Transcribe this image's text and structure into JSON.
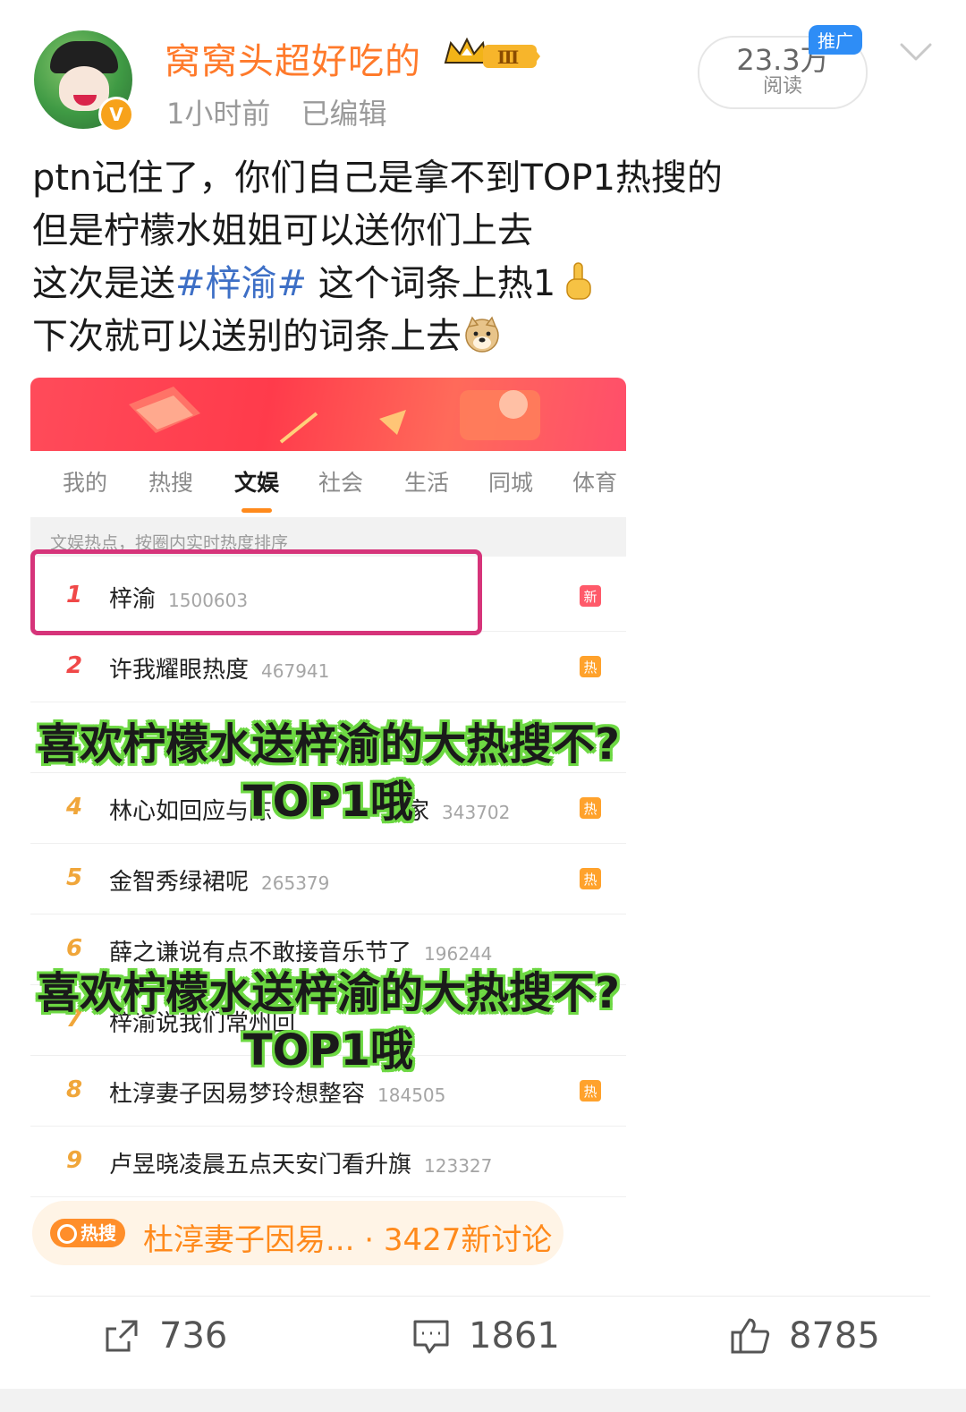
{
  "post": {
    "username": "窝窝头超好吃的",
    "level_badge": "Ⅲ",
    "time": "1小时前",
    "edited": "已编辑",
    "reads_value": "23.3万",
    "reads_label": "阅读",
    "promo_label": "推广",
    "verified_mark": "V",
    "text_lines": {
      "line1": "ptn记住了，你们自己是拿不到TOP1热搜的",
      "line2": "但是柠檬水姐姐可以送你们上去",
      "line3_prefix": "这次是送",
      "line3_tag": "#梓渝#",
      "line3_suffix": " 这个词条上热1",
      "line4": "下次就可以送别的词条上去"
    }
  },
  "embedded_screenshot": {
    "tabs": [
      "我的",
      "热搜",
      "文娱",
      "社会",
      "生活",
      "同城",
      "体育"
    ],
    "active_tab": "文娱",
    "subheader": "文娱热点，按圈内实时热度排序",
    "rows": [
      {
        "rank": "1",
        "title": "梓渝",
        "count": "1500603",
        "badge": "新"
      },
      {
        "rank": "2",
        "title": "许我耀眼热度",
        "count": "467941",
        "badge": "热"
      },
      {
        "rank": "4",
        "title": "林心如回应与陈",
        "count": "343702",
        "badge": "热",
        "title_tail": "家"
      },
      {
        "rank": "5",
        "title": "金智秀绿裙呢",
        "count": "265379",
        "badge": "热"
      },
      {
        "rank": "6",
        "title": "薛之谦说有点不敢接音乐节了",
        "count": "196244",
        "badge": ""
      },
      {
        "rank": "7",
        "title": "梓渝说我们常州回",
        "count": "",
        "badge": ""
      },
      {
        "rank": "8",
        "title": "杜淳妻子因易梦玲想整容",
        "count": "184505",
        "badge": "热"
      },
      {
        "rank": "9",
        "title": "卢昱晓凌晨五点天安门看升旗",
        "count": "123327",
        "badge": ""
      }
    ],
    "overlay_line1": "喜欢柠檬水送梓渝的大热搜不?",
    "overlay_line2": "TOP1哦"
  },
  "trend": {
    "label": "热搜",
    "text": "杜淳妻子因易... · 3427新讨论"
  },
  "actions": {
    "share": "736",
    "comment": "1861",
    "like": "8785"
  },
  "colors": {
    "username": "#ff7a2b",
    "hashtag": "#3d6fc6",
    "accent_orange": "#ff8a1c",
    "highlight_box": "#d6347a",
    "overlay_outline": "#6dd843"
  }
}
